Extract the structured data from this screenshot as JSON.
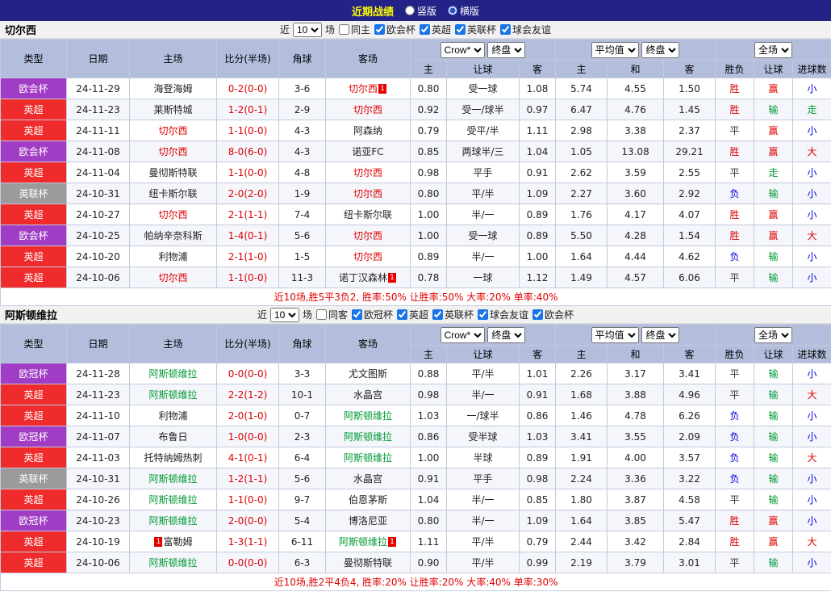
{
  "topbar": {
    "title": "近期战绩",
    "vertical_label": "竖版",
    "horizontal_label": "横版"
  },
  "table_header": {
    "columns": {
      "type": "类型",
      "date": "日期",
      "home": "主场",
      "score": "比分(半场)",
      "corner": "角球",
      "away": "客场",
      "home_odds": "主",
      "handicap": "让球",
      "away_odds": "客",
      "avg_home": "主",
      "avg_draw": "和",
      "avg_away": "客",
      "wdl": "胜负",
      "handicap_result": "让球",
      "goals": "进球数"
    },
    "selects": {
      "bookmaker": "Crow*",
      "final": "终盘",
      "average": "平均值",
      "fulltime": "全场"
    }
  },
  "filter_labels": {
    "near": "近",
    "games": "场"
  },
  "sections": [
    {
      "team": "切尔西",
      "filters": {
        "count": "10",
        "same_label": "同主",
        "comps": [
          "欧会杯",
          "英超",
          "英联杯",
          "球会友谊"
        ]
      },
      "rows": [
        {
          "type": "欧会杯",
          "type_color": "purple",
          "date": "24-11-29",
          "home": "海登海姆",
          "home_color": "black",
          "score": "0-2(0-0)",
          "corner": "3-6",
          "away": "切尔西",
          "away_color": "red",
          "away_card": "1",
          "odds_home": "0.80",
          "handicap": "受一球",
          "odds_away": "1.08",
          "avg_home": "5.74",
          "avg_draw": "4.55",
          "avg_away": "1.50",
          "wdl": "胜",
          "wdl_color": "red",
          "hres": "赢",
          "hres_color": "red",
          "goals": "小",
          "goals_color": "blue"
        },
        {
          "type": "英超",
          "type_color": "red",
          "date": "24-11-23",
          "home": "莱斯特城",
          "home_color": "black",
          "score": "1-2(0-1)",
          "corner": "2-9",
          "away": "切尔西",
          "away_color": "red",
          "odds_home": "0.92",
          "handicap": "受一/球半",
          "odds_away": "0.97",
          "avg_home": "6.47",
          "avg_draw": "4.76",
          "avg_away": "1.45",
          "wdl": "胜",
          "wdl_color": "red",
          "hres": "输",
          "hres_color": "green",
          "goals": "走",
          "goals_color": "green"
        },
        {
          "type": "英超",
          "type_color": "red",
          "date": "24-11-11",
          "home": "切尔西",
          "home_color": "red",
          "score": "1-1(0-0)",
          "corner": "4-3",
          "away": "阿森纳",
          "away_color": "black",
          "odds_home": "0.79",
          "handicap": "受平/半",
          "odds_away": "1.11",
          "avg_home": "2.98",
          "avg_draw": "3.38",
          "avg_away": "2.37",
          "wdl": "平",
          "wdl_color": "black",
          "hres": "赢",
          "hres_color": "red",
          "goals": "小",
          "goals_color": "blue"
        },
        {
          "type": "欧会杯",
          "type_color": "purple",
          "date": "24-11-08",
          "home": "切尔西",
          "home_color": "red",
          "score": "8-0(6-0)",
          "corner": "4-3",
          "away": "诺亚FC",
          "away_color": "black",
          "odds_home": "0.85",
          "handicap": "两球半/三",
          "odds_away": "1.04",
          "avg_home": "1.05",
          "avg_draw": "13.08",
          "avg_away": "29.21",
          "wdl": "胜",
          "wdl_color": "red",
          "hres": "赢",
          "hres_color": "red",
          "goals": "大",
          "goals_color": "red"
        },
        {
          "type": "英超",
          "type_color": "red",
          "date": "24-11-04",
          "home": "曼彻斯特联",
          "home_color": "black",
          "score": "1-1(0-0)",
          "corner": "4-8",
          "away": "切尔西",
          "away_color": "red",
          "odds_home": "0.98",
          "handicap": "平手",
          "odds_away": "0.91",
          "avg_home": "2.62",
          "avg_draw": "3.59",
          "avg_away": "2.55",
          "wdl": "平",
          "wdl_color": "black",
          "hres": "走",
          "hres_color": "green",
          "goals": "小",
          "goals_color": "blue"
        },
        {
          "type": "英联杯",
          "type_color": "gray",
          "date": "24-10-31",
          "home": "纽卡斯尔联",
          "home_color": "black",
          "score": "2-0(2-0)",
          "corner": "1-9",
          "away": "切尔西",
          "away_color": "red",
          "odds_home": "0.80",
          "handicap": "平/半",
          "odds_away": "1.09",
          "avg_home": "2.27",
          "avg_draw": "3.60",
          "avg_away": "2.92",
          "wdl": "负",
          "wdl_color": "blue",
          "hres": "输",
          "hres_color": "green",
          "goals": "小",
          "goals_color": "blue"
        },
        {
          "type": "英超",
          "type_color": "red",
          "date": "24-10-27",
          "home": "切尔西",
          "home_color": "red",
          "score": "2-1(1-1)",
          "corner": "7-4",
          "away": "纽卡斯尔联",
          "away_color": "black",
          "odds_home": "1.00",
          "handicap": "半/一",
          "odds_away": "0.89",
          "avg_home": "1.76",
          "avg_draw": "4.17",
          "avg_away": "4.07",
          "wdl": "胜",
          "wdl_color": "red",
          "hres": "赢",
          "hres_color": "red",
          "goals": "小",
          "goals_color": "blue"
        },
        {
          "type": "欧会杯",
          "type_color": "purple",
          "date": "24-10-25",
          "home": "帕纳辛奈科斯",
          "home_color": "black",
          "score": "1-4(0-1)",
          "corner": "5-6",
          "away": "切尔西",
          "away_color": "red",
          "odds_home": "1.00",
          "handicap": "受一球",
          "odds_away": "0.89",
          "avg_home": "5.50",
          "avg_draw": "4.28",
          "avg_away": "1.54",
          "wdl": "胜",
          "wdl_color": "red",
          "hres": "赢",
          "hres_color": "red",
          "goals": "大",
          "goals_color": "red"
        },
        {
          "type": "英超",
          "type_color": "red",
          "date": "24-10-20",
          "home": "利物浦",
          "home_color": "black",
          "score": "2-1(1-0)",
          "corner": "1-5",
          "away": "切尔西",
          "away_color": "red",
          "odds_home": "0.89",
          "handicap": "半/一",
          "odds_away": "1.00",
          "avg_home": "1.64",
          "avg_draw": "4.44",
          "avg_away": "4.62",
          "wdl": "负",
          "wdl_color": "blue",
          "hres": "输",
          "hres_color": "green",
          "goals": "小",
          "goals_color": "blue"
        },
        {
          "type": "英超",
          "type_color": "red",
          "date": "24-10-06",
          "home": "切尔西",
          "home_color": "red",
          "score": "1-1(0-0)",
          "corner": "11-3",
          "away": "诺丁汉森林",
          "away_color": "black",
          "away_card": "1",
          "odds_home": "0.78",
          "handicap": "一球",
          "odds_away": "1.12",
          "avg_home": "1.49",
          "avg_draw": "4.57",
          "avg_away": "6.06",
          "wdl": "平",
          "wdl_color": "black",
          "hres": "输",
          "hres_color": "green",
          "goals": "小",
          "goals_color": "blue"
        }
      ],
      "summary": "近10场,胜5平3负2, 胜率:50% 让胜率:50% 大率:20% 单率:40%"
    },
    {
      "team": "阿斯顿维拉",
      "filters": {
        "count": "10",
        "same_label": "同客",
        "comps": [
          "欧冠杯",
          "英超",
          "英联杯",
          "球会友谊",
          "欧会杯"
        ]
      },
      "rows": [
        {
          "type": "欧冠杯",
          "type_color": "purple",
          "date": "24-11-28",
          "home": "阿斯顿维拉",
          "home_color": "green",
          "score": "0-0(0-0)",
          "corner": "3-3",
          "away": "尤文图斯",
          "away_color": "black",
          "odds_home": "0.88",
          "handicap": "平/半",
          "odds_away": "1.01",
          "avg_home": "2.26",
          "avg_draw": "3.17",
          "avg_away": "3.41",
          "wdl": "平",
          "wdl_color": "black",
          "hres": "输",
          "hres_color": "green",
          "goals": "小",
          "goals_color": "blue"
        },
        {
          "type": "英超",
          "type_color": "red",
          "date": "24-11-23",
          "home": "阿斯顿维拉",
          "home_color": "green",
          "score": "2-2(1-2)",
          "corner": "10-1",
          "away": "水晶宫",
          "away_color": "black",
          "odds_home": "0.98",
          "handicap": "半/一",
          "odds_away": "0.91",
          "avg_home": "1.68",
          "avg_draw": "3.88",
          "avg_away": "4.96",
          "wdl": "平",
          "wdl_color": "black",
          "hres": "输",
          "hres_color": "green",
          "goals": "大",
          "goals_color": "red"
        },
        {
          "type": "英超",
          "type_color": "red",
          "date": "24-11-10",
          "home": "利物浦",
          "home_color": "black",
          "score": "2-0(1-0)",
          "corner": "0-7",
          "away": "阿斯顿维拉",
          "away_color": "green",
          "odds_home": "1.03",
          "handicap": "一/球半",
          "odds_away": "0.86",
          "avg_home": "1.46",
          "avg_draw": "4.78",
          "avg_away": "6.26",
          "wdl": "负",
          "wdl_color": "blue",
          "hres": "输",
          "hres_color": "green",
          "goals": "小",
          "goals_color": "blue"
        },
        {
          "type": "欧冠杯",
          "type_color": "purple",
          "date": "24-11-07",
          "home": "布鲁日",
          "home_color": "black",
          "score": "1-0(0-0)",
          "corner": "2-3",
          "away": "阿斯顿维拉",
          "away_color": "green",
          "odds_home": "0.86",
          "handicap": "受半球",
          "odds_away": "1.03",
          "avg_home": "3.41",
          "avg_draw": "3.55",
          "avg_away": "2.09",
          "wdl": "负",
          "wdl_color": "blue",
          "hres": "输",
          "hres_color": "green",
          "goals": "小",
          "goals_color": "blue"
        },
        {
          "type": "英超",
          "type_color": "red",
          "date": "24-11-03",
          "home": "托特纳姆热刺",
          "home_color": "black",
          "score": "4-1(0-1)",
          "corner": "6-4",
          "away": "阿斯顿维拉",
          "away_color": "green",
          "odds_home": "1.00",
          "handicap": "半球",
          "odds_away": "0.89",
          "avg_home": "1.91",
          "avg_draw": "4.00",
          "avg_away": "3.57",
          "wdl": "负",
          "wdl_color": "blue",
          "hres": "输",
          "hres_color": "green",
          "goals": "大",
          "goals_color": "red"
        },
        {
          "type": "英联杯",
          "type_color": "gray",
          "date": "24-10-31",
          "home": "阿斯顿维拉",
          "home_color": "green",
          "score": "1-2(1-1)",
          "corner": "5-6",
          "away": "水晶宫",
          "away_color": "black",
          "odds_home": "0.91",
          "handicap": "平手",
          "odds_away": "0.98",
          "avg_home": "2.24",
          "avg_draw": "3.36",
          "avg_away": "3.22",
          "wdl": "负",
          "wdl_color": "blue",
          "hres": "输",
          "hres_color": "green",
          "goals": "小",
          "goals_color": "blue"
        },
        {
          "type": "英超",
          "type_color": "red",
          "date": "24-10-26",
          "home": "阿斯顿维拉",
          "home_color": "green",
          "score": "1-1(0-0)",
          "corner": "9-7",
          "away": "伯恩茅斯",
          "away_color": "black",
          "odds_home": "1.04",
          "handicap": "半/一",
          "odds_away": "0.85",
          "avg_home": "1.80",
          "avg_draw": "3.87",
          "avg_away": "4.58",
          "wdl": "平",
          "wdl_color": "black",
          "hres": "输",
          "hres_color": "green",
          "goals": "小",
          "goals_color": "blue"
        },
        {
          "type": "欧冠杯",
          "type_color": "purple",
          "date": "24-10-23",
          "home": "阿斯顿维拉",
          "home_color": "green",
          "score": "2-0(0-0)",
          "corner": "5-4",
          "away": "博洛尼亚",
          "away_color": "black",
          "odds_home": "0.80",
          "handicap": "半/一",
          "odds_away": "1.09",
          "avg_home": "1.64",
          "avg_draw": "3.85",
          "avg_away": "5.47",
          "wdl": "胜",
          "wdl_color": "red",
          "hres": "赢",
          "hres_color": "red",
          "goals": "小",
          "goals_color": "blue"
        },
        {
          "type": "英超",
          "type_color": "red",
          "date": "24-10-19",
          "home": "富勒姆",
          "home_color": "black",
          "home_card_pre": "1",
          "score": "1-3(1-1)",
          "corner": "6-11",
          "away": "阿斯顿维拉",
          "away_color": "green",
          "away_card": "1",
          "odds_home": "1.11",
          "handicap": "平/半",
          "odds_away": "0.79",
          "avg_home": "2.44",
          "avg_draw": "3.42",
          "avg_away": "2.84",
          "wdl": "胜",
          "wdl_color": "red",
          "hres": "赢",
          "hres_color": "red",
          "goals": "大",
          "goals_color": "red"
        },
        {
          "type": "英超",
          "type_color": "red",
          "date": "24-10-06",
          "home": "阿斯顿维拉",
          "home_color": "green",
          "score": "0-0(0-0)",
          "corner": "6-3",
          "away": "曼彻斯特联",
          "away_color": "black",
          "odds_home": "0.90",
          "handicap": "平/半",
          "odds_away": "0.99",
          "avg_home": "2.19",
          "avg_draw": "3.79",
          "avg_away": "3.01",
          "wdl": "平",
          "wdl_color": "black",
          "hres": "输",
          "hres_color": "green",
          "goals": "小",
          "goals_color": "blue"
        }
      ],
      "summary": "近10场,胜2平4负4, 胜率:20% 让胜率:20% 大率:40% 单率:30%"
    }
  ]
}
